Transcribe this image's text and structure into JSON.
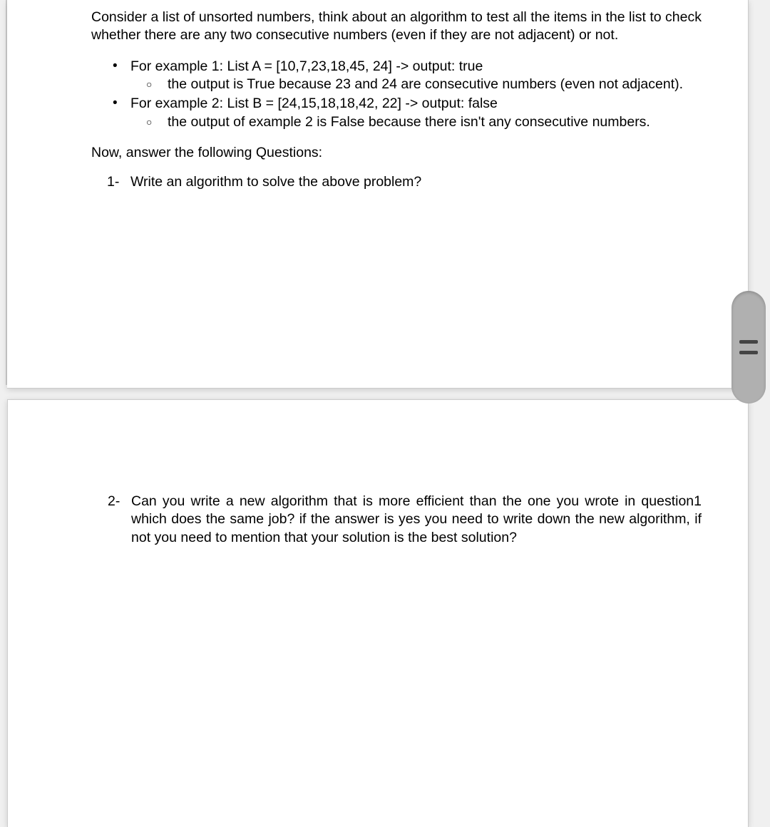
{
  "intro": "Consider a list of unsorted numbers, think about an algorithm to test all the items in the list to check whether there are any two consecutive numbers (even if they are not adjacent) or not.",
  "examples": [
    {
      "text": "For example 1: List A = [10,7,23,18,45, 24] -> output: true",
      "explanation": "the output is True because 23 and 24 are consecutive numbers (even not adjacent)."
    },
    {
      "text": "For example 2: List B = [24,15,18,18,42, 22] -> output: false",
      "explanation": "the output of example 2 is False because there isn't any consecutive numbers."
    }
  ],
  "prompt": "Now, answer the following Questions:",
  "questions": [
    {
      "num": "1-",
      "text": "Write an algorithm to solve the above problem?"
    },
    {
      "num": "2-",
      "text": "Can you write a new algorithm that is more efficient than the one you wrote in question1 which does the same job? if the answer is yes you need to write down the new algorithm, if not you need to mention that your solution is the best solution?"
    }
  ]
}
